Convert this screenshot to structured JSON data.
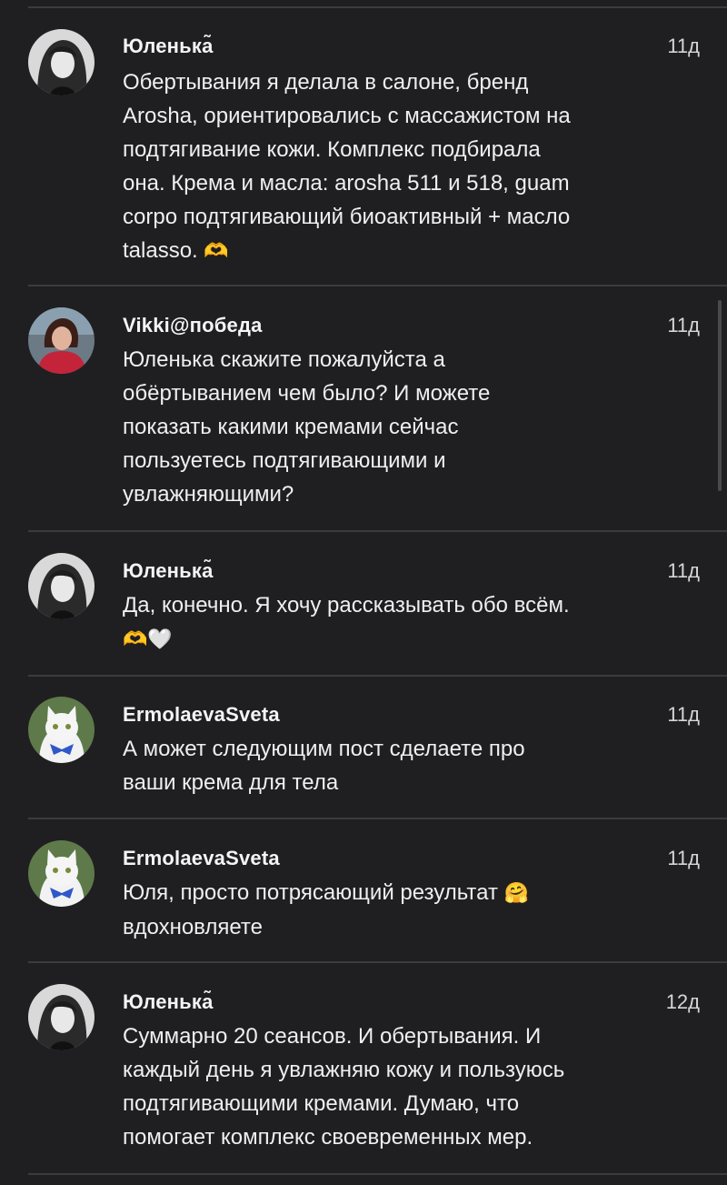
{
  "comments": [
    {
      "author": "Юленька̃",
      "time": "11д",
      "lines": [
        "Обертывания я делала в салоне, бренд",
        "Arosha, ориентировались с массажистом на",
        "подтягивание кожи. Комплекс подбирала",
        "она. Крема и масла: arosha 511 и 518, guam",
        "corpo подтягивающий биоактивный + масло",
        "talasso."
      ],
      "emoji": "🫶",
      "avatar": "avatar-woman-bw"
    },
    {
      "author": "Vikki@победа",
      "time": "11д",
      "lines": [
        "Юленька скажите пожалуйста а",
        "обёртыванием чем было? И можете",
        "показать какими кремами сейчас",
        "пользуетесь подтягивающими и",
        "увлажняющими?"
      ],
      "avatar": "avatar-woman-red"
    },
    {
      "author": "Юленька̃",
      "time": "11д",
      "lines": [
        "Да, конечно. Я хочу рассказывать обо всём."
      ],
      "emoji": "🫶🤍",
      "avatar": "avatar-woman-bw"
    },
    {
      "author": "ErmolaevaSveta",
      "time": "11д",
      "lines": [
        "А может следующим пост сделаете про",
        "ваши крема для тела"
      ],
      "avatar": "avatar-white-cat"
    },
    {
      "author": "ErmolaevaSveta",
      "time": "11д",
      "lines": [
        "Юля, просто потрясающий результат",
        "вдохновляете"
      ],
      "emoji": "🤗",
      "avatar": "avatar-white-cat"
    },
    {
      "author": "Юленька̃",
      "time": "12д",
      "lines": [
        "Суммарно 20 сеансов. И обертывания. И",
        "каждый день я увлажняю кожу и пользуюсь",
        "подтягивающими кремами. Думаю, что",
        "помогает комплекс своевременных мер."
      ],
      "avatar": "avatar-woman-bw"
    }
  ]
}
